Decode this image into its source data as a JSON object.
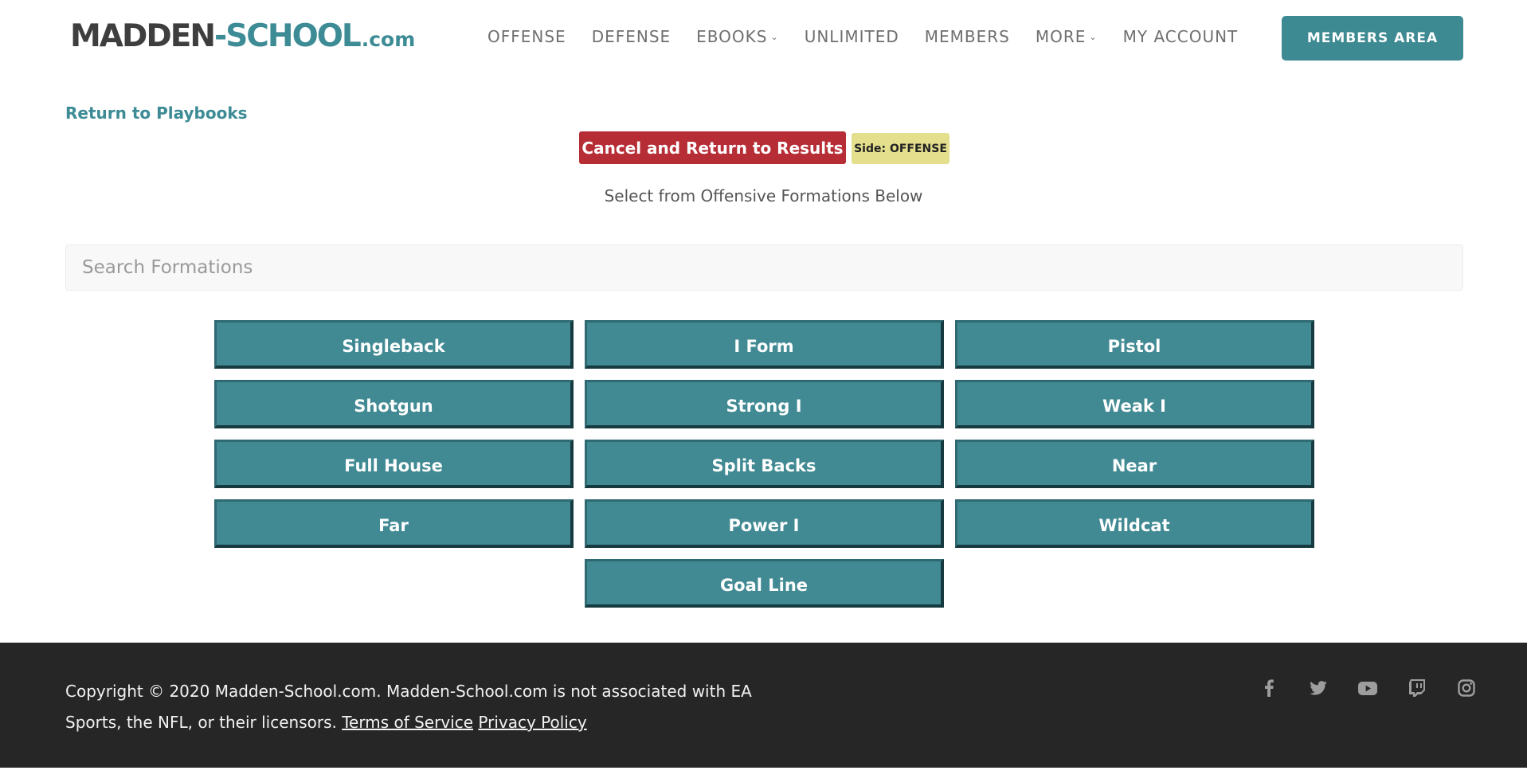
{
  "header": {
    "logo": {
      "part1": "MADDEN",
      "part2": "-SCHOOL",
      "part3": ".com"
    },
    "nav": [
      {
        "label": "OFFENSE",
        "has_dropdown": false
      },
      {
        "label": "DEFENSE",
        "has_dropdown": false
      },
      {
        "label": "EBOOKS",
        "has_dropdown": true
      },
      {
        "label": "UNLIMITED",
        "has_dropdown": false
      },
      {
        "label": "MEMBERS",
        "has_dropdown": false
      },
      {
        "label": "MORE",
        "has_dropdown": true
      },
      {
        "label": "MY ACCOUNT",
        "has_dropdown": false
      }
    ],
    "members_button": "MEMBERS AREA"
  },
  "main": {
    "return_link": "Return to Playbooks",
    "cancel_button": "Cancel and Return to Results",
    "side_badge": "Side: OFFENSE",
    "instruction": "Select from Offensive Formations Below",
    "search": {
      "placeholder": "Search Formations",
      "value": ""
    },
    "formations": [
      "Singleback",
      "I Form",
      "Pistol",
      "Shotgun",
      "Strong I",
      "Weak I",
      "Full House",
      "Split Backs",
      "Near",
      "Far",
      "Power I",
      "Wildcat",
      "Goal Line"
    ]
  },
  "footer": {
    "copyright": "Copyright © 2020 Madden-School.com. Madden-School.com is not associated with EA Sports, the NFL, or their licensors.",
    "terms_link": "Terms of Service",
    "privacy_link": "Privacy Policy",
    "socials": [
      "facebook-icon",
      "twitter-icon",
      "youtube-icon",
      "twitch-icon",
      "instagram-icon"
    ]
  },
  "colors": {
    "brand_teal": "#3e8a93",
    "cancel_red": "#b72d35",
    "badge_yellow": "#e3df8d",
    "footer_bg": "#262626"
  }
}
